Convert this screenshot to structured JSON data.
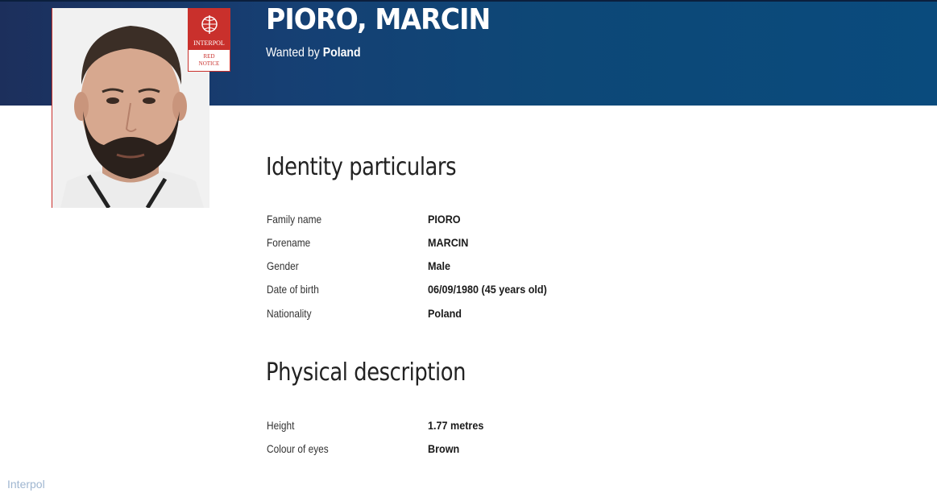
{
  "header": {
    "name": "PIORO, MARCIN",
    "wanted_prefix": "Wanted by",
    "wanted_country": "Poland"
  },
  "badge": {
    "org": "INTERPOL",
    "notice_line1": "RED",
    "notice_line2": "NOTICE"
  },
  "identity": {
    "title": "Identity particulars",
    "rows": [
      {
        "label": "Family name",
        "value": "PIORO"
      },
      {
        "label": "Forename",
        "value": "MARCIN"
      },
      {
        "label": "Gender",
        "value": "Male"
      },
      {
        "label": "Date of birth",
        "value": "06/09/1980 (45 years old)"
      },
      {
        "label": "Nationality",
        "value": "Poland"
      }
    ]
  },
  "physical": {
    "title": "Physical description",
    "rows": [
      {
        "label": "Height",
        "value": "1.77 metres"
      },
      {
        "label": "Colour of eyes",
        "value": "Brown"
      }
    ]
  },
  "watermark": "Interpol",
  "colors": {
    "header_dark": "#1c2f5c",
    "header_light": "#0a4b7d",
    "red_notice": "#c9302c"
  }
}
